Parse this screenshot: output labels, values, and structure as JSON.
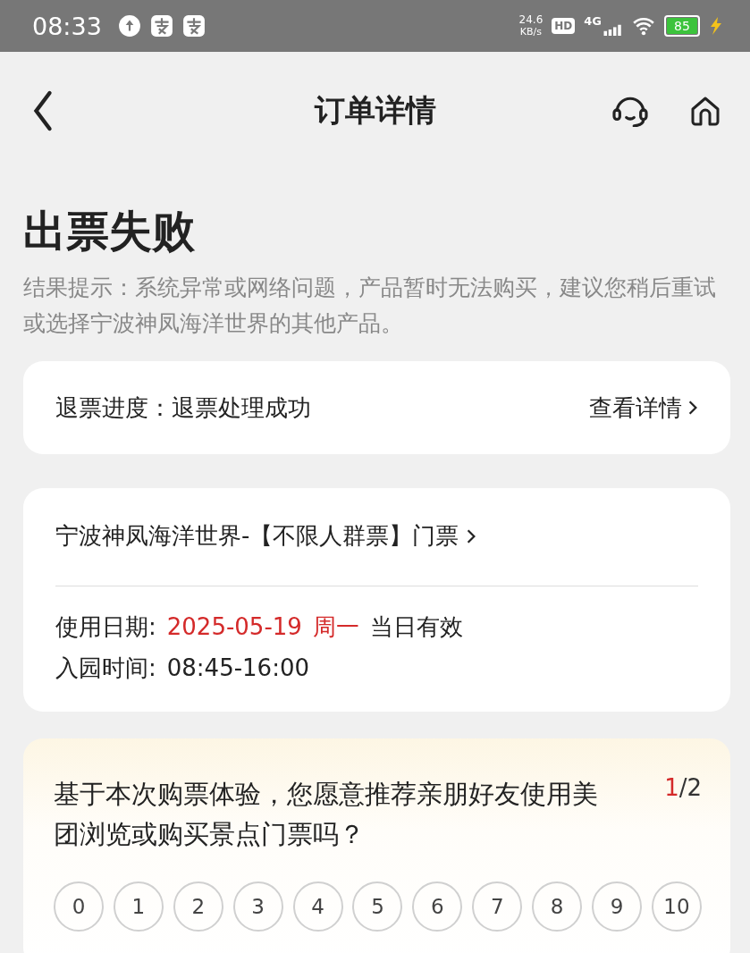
{
  "status_bar": {
    "time": "08:33",
    "speed_value": "24.6",
    "speed_unit": "KB/s",
    "hd": "HD",
    "network": "4G",
    "battery": "85",
    "charging": true
  },
  "header": {
    "title": "订单详情"
  },
  "result": {
    "title": "出票失败",
    "note": "结果提示：系统异常或网络问题，产品暂时无法购买，建议您稍后重试或选择宁波神凤海洋世界的其他产品。"
  },
  "refund": {
    "label": "退票进度：退票处理成功",
    "link": "查看详情"
  },
  "ticket": {
    "product": "宁波神凤海洋世界-【不限人群票】门票",
    "date_label": "使用日期:",
    "date": "2025-05-19",
    "weekday": "周一",
    "validity": "当日有效",
    "time_label": "入园时间:",
    "time": "08:45-16:00"
  },
  "survey": {
    "question": "基于本次购票体验，您愿意推荐亲朋好友使用美团浏览或购买景点门票吗？",
    "page_current": "1",
    "page_total": "/2",
    "scale": [
      "0",
      "1",
      "2",
      "3",
      "4",
      "5",
      "6",
      "7",
      "8",
      "9",
      "10"
    ]
  }
}
